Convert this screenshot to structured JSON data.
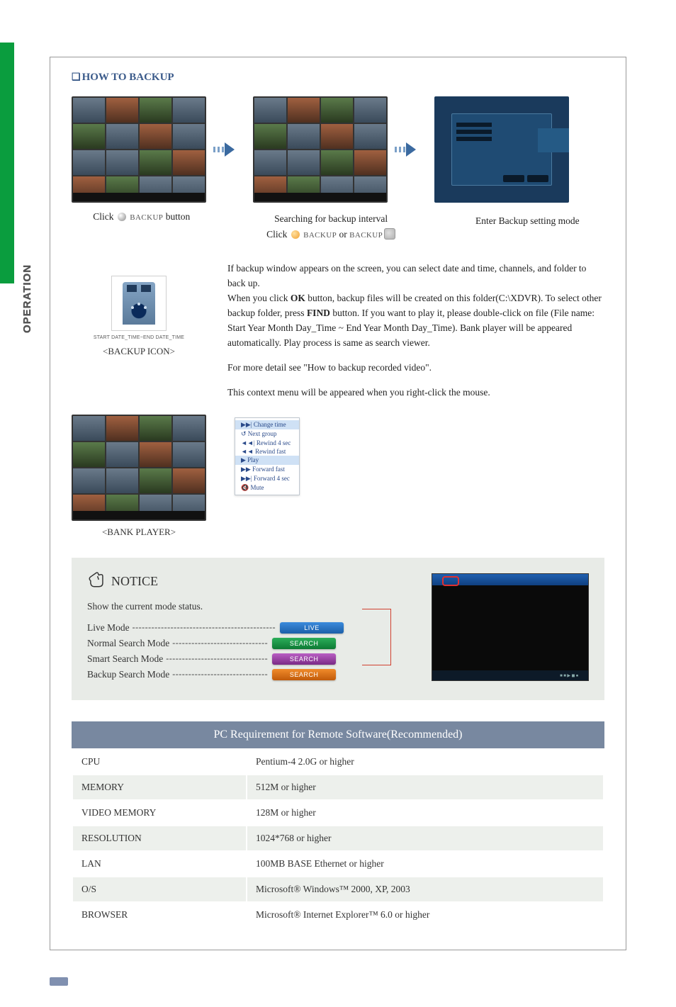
{
  "sideLabel": "OPERATION",
  "heading": "HOW TO BACKUP",
  "captions": {
    "c1_pre": "Click ",
    "c1_icon": "disc-icon",
    "c1_word": "BACKUP",
    "c1_post": " button",
    "c2_line1": "Searching for backup interval",
    "c2_pre": "Click ",
    "c2_word1": "BACKUP",
    "c2_mid": " or ",
    "c2_word2": "BACKUP",
    "c3": "Enter Backup setting mode"
  },
  "backupIcon": {
    "tiny": "START DATE_TIME~END DATE_TIME",
    "label": "<BACKUP ICON>"
  },
  "paragraphs": {
    "p1a": "If backup window appears on the screen, you can select date and time, channels, and folder to back up.",
    "p1b_pre": "When you click ",
    "p1b_bold1": "OK",
    "p1b_mid": " button, backup files will be created on this folder(C:\\XDVR). To select other backup folder, press ",
    "p1b_bold2": "FIND",
    "p1b_post": " button. If you want to play it, please double-click on file (File name: Start Year Month Day_Time ~ End Year Month Day_Time). Bank player will be appeared automatically. Play process is same as search viewer.",
    "p2": "For more detail see \"How to backup recorded video\".",
    "p3": "This context menu will be appeared when you right-click the mouse."
  },
  "bankPlayerLabel": "<BANK PLAYER>",
  "contextMenu": [
    "Change time",
    "Next group",
    "Rewind 4 sec",
    "Rewind fast",
    "Play",
    "Forward fast",
    "Forward 4 sec",
    "Mute"
  ],
  "notice": {
    "title": "NOTICE",
    "desc": "Show the current mode status.",
    "modes": [
      {
        "label": "Live Mode",
        "bar": "LIVE",
        "cls": "bar-blue",
        "dash": "---------------------------------------------"
      },
      {
        "label": "Normal Search Mode",
        "bar": "SEARCH",
        "cls": "bar-green",
        "dash": "------------------------------"
      },
      {
        "label": "Smart Search Mode",
        "bar": "SEARCH",
        "cls": "bar-purple",
        "dash": "--------------------------------"
      },
      {
        "label": "Backup Search Mode",
        "bar": "SEARCH",
        "cls": "bar-orange",
        "dash": "------------------------------"
      }
    ]
  },
  "pcTable": {
    "title": "PC Requirement for Remote Software(Recommended)",
    "rows": [
      {
        "k": "CPU",
        "v": "Pentium-4 2.0G or higher"
      },
      {
        "k": "MEMORY",
        "v": "512M or higher"
      },
      {
        "k": "VIDEO MEMORY",
        "v": "128M or higher"
      },
      {
        "k": "RESOLUTION",
        "v": "1024*768 or higher"
      },
      {
        "k": "LAN",
        "v": "100MB BASE Ethernet or higher"
      },
      {
        "k": "O/S",
        "v": "Microsoft® Windows™ 2000, XP, 2003"
      },
      {
        "k": "BROWSER",
        "v": "Microsoft® Internet Explorer™ 6.0 or higher"
      }
    ]
  }
}
